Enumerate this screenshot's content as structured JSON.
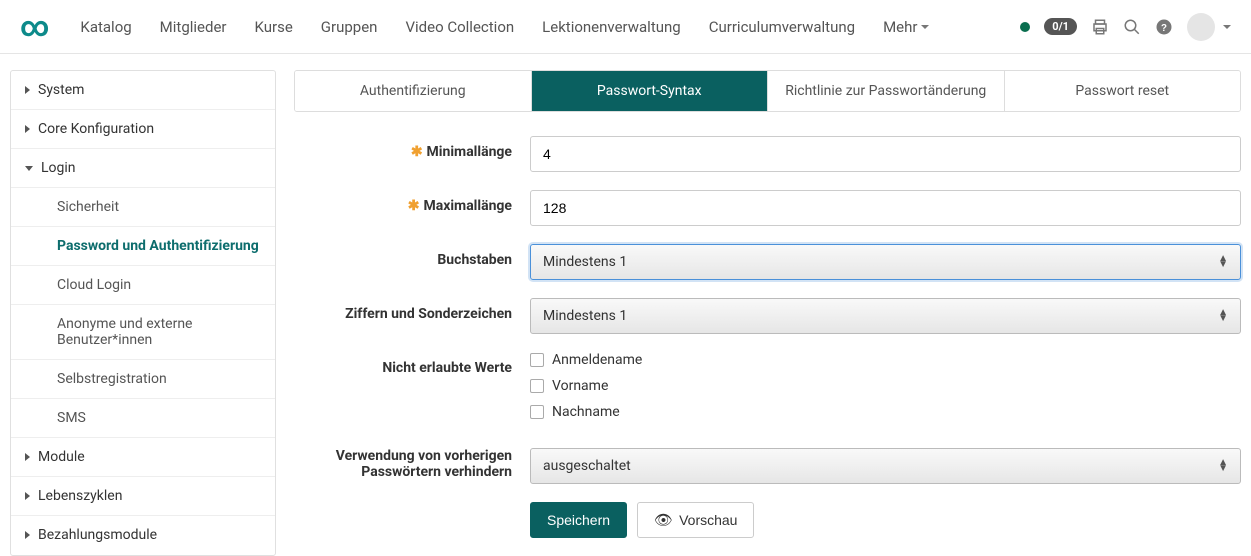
{
  "nav": {
    "items": [
      "Katalog",
      "Mitglieder",
      "Kurse",
      "Gruppen",
      "Video Collection",
      "Lektionenverwaltung",
      "Curriculumverwaltung"
    ],
    "more": "Mehr",
    "pill": "0/1"
  },
  "sidebar": {
    "system": "System",
    "core": "Core Konfiguration",
    "login": "Login",
    "login_children": {
      "security": "Sicherheit",
      "password_auth": "Password und Authentifizierung",
      "cloud": "Cloud Login",
      "anon": "Anonyme und externe Benutzer*innen",
      "selfreg": "Selbstregistration",
      "sms": "SMS"
    },
    "module": "Module",
    "lifecycles": "Lebenszyklen",
    "payment": "Bezahlungsmodule"
  },
  "tabs": {
    "auth": "Authentifizierung",
    "syntax": "Passwort-Syntax",
    "policy": "Richtlinie zur Passwortänderung",
    "reset": "Passwort reset"
  },
  "form": {
    "min_label": "Minimallänge",
    "min_value": "4",
    "max_label": "Maximallänge",
    "max_value": "128",
    "letters_label": "Buchstaben",
    "letters_value": "Mindestens 1",
    "digits_label": "Ziffern und Sonderzeichen",
    "digits_value": "Mindestens 1",
    "forbidden_label": "Nicht erlaubte Werte",
    "forbidden_opts": {
      "login": "Anmeldename",
      "first": "Vorname",
      "last": "Nachname"
    },
    "history_label": "Verwendung von vorherigen Passwörtern verhindern",
    "history_value": "ausgeschaltet",
    "save": "Speichern",
    "preview": "Vorschau"
  }
}
